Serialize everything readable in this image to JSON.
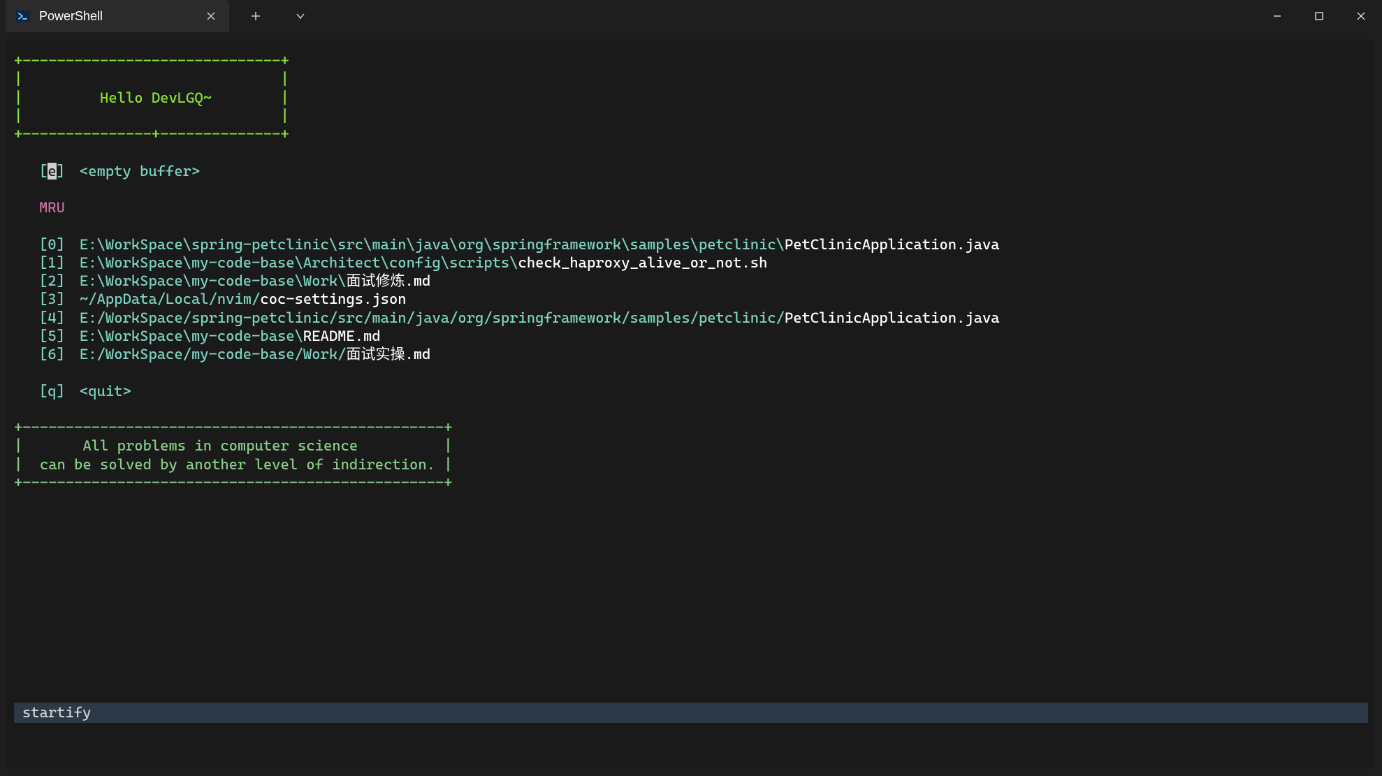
{
  "titlebar": {
    "tab_title": "PowerShell"
  },
  "box_header": {
    "top": "+------------------------------+",
    "empty1": "|                              |",
    "center": "|         Hello DevLGQ~        |",
    "empty2": "|                              |",
    "bottom": "+---------------+--------------+"
  },
  "empty_buffer": {
    "key_open": "[",
    "key_char": "e",
    "key_close": "]",
    "label": "<empty buffer>"
  },
  "mru_label": "MRU",
  "mru": [
    {
      "key": "[0]",
      "dir": "E:\\WorkSpace\\spring-petclinic\\src\\main\\java\\org\\springframework\\samples\\petclinic\\",
      "file": "PetClinicApplication.java"
    },
    {
      "key": "[1]",
      "dir": "E:\\WorkSpace\\my-code-base\\Architect\\config\\scripts\\",
      "file": "check_haproxy_alive_or_not.sh"
    },
    {
      "key": "[2]",
      "dir": "E:\\WorkSpace\\my-code-base\\Work\\",
      "file": "面试修炼.md"
    },
    {
      "key": "[3]",
      "dir": "~/AppData/Local/nvim/",
      "file": "coc-settings.json"
    },
    {
      "key": "[4]",
      "dir": "E:/WorkSpace/spring-petclinic/src/main/java/org/springframework/samples/petclinic/",
      "file": "PetClinicApplication.java"
    },
    {
      "key": "[5]",
      "dir": "E:\\WorkSpace\\my-code-base\\",
      "file": "README.md"
    },
    {
      "key": "[6]",
      "dir": "E:/WorkSpace/my-code-base/Work/",
      "file": "面试实操.md"
    }
  ],
  "quit": {
    "key": "[q]",
    "label": "<quit>"
  },
  "box_footer": {
    "top": "+-------------------------------------------------+",
    "line1": "|       All problems in computer science          |",
    "line2": "|  can be solved by another level of indirection. |",
    "bottom": "+-------------------------------------------------+"
  },
  "statusline": "startify"
}
